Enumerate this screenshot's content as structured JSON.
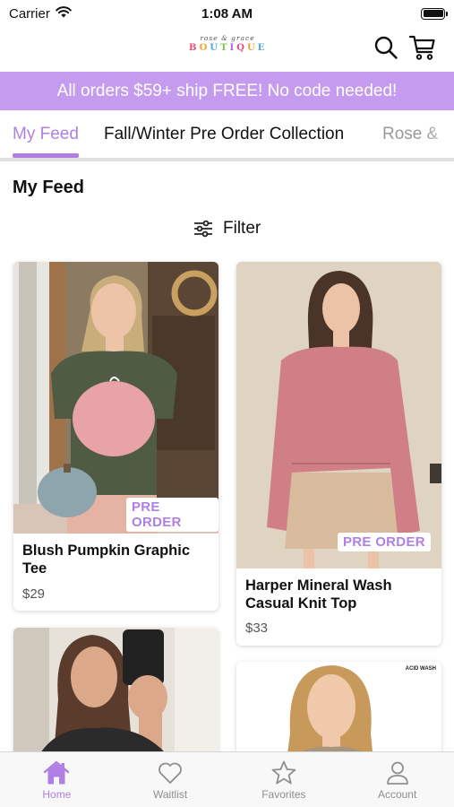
{
  "status_bar": {
    "carrier": "Carrier",
    "time": "1:08 AM"
  },
  "header": {
    "logo_script": "rose & grace",
    "logo_word": [
      "B",
      "O",
      "U",
      "T",
      "I",
      "Q",
      "U",
      "E"
    ]
  },
  "promo": {
    "text": "All orders $59+ ship FREE! No code needed!"
  },
  "tabs": [
    {
      "label": "My Feed",
      "active": true
    },
    {
      "label": "Fall/Winter Pre Order Collection",
      "active": false
    },
    {
      "label": "Rose &",
      "active": false
    }
  ],
  "feed": {
    "title": "My Feed",
    "filter_label": "Filter"
  },
  "products": [
    {
      "name": "Blush Pumpkin Graphic Tee",
      "price": "$29",
      "badge": "PRE ORDER"
    },
    {
      "name": "Harper Mineral Wash Casual Knit Top",
      "price": "$33",
      "badge": "PRE ORDER"
    },
    {
      "name": "",
      "price": "",
      "badge": ""
    },
    {
      "name": "",
      "price": "",
      "badge": "",
      "tag": "ACID WASH"
    }
  ],
  "tab_bar": [
    {
      "label": "Home",
      "icon": "home-icon",
      "active": true
    },
    {
      "label": "Waitlist",
      "icon": "heart-icon",
      "active": false
    },
    {
      "label": "Favorites",
      "icon": "star-icon",
      "active": false
    },
    {
      "label": "Account",
      "icon": "person-icon",
      "active": false
    }
  ],
  "colors": {
    "accent": "#b07fe3",
    "banner": "#c49bee",
    "inactive": "#8e8e93"
  }
}
